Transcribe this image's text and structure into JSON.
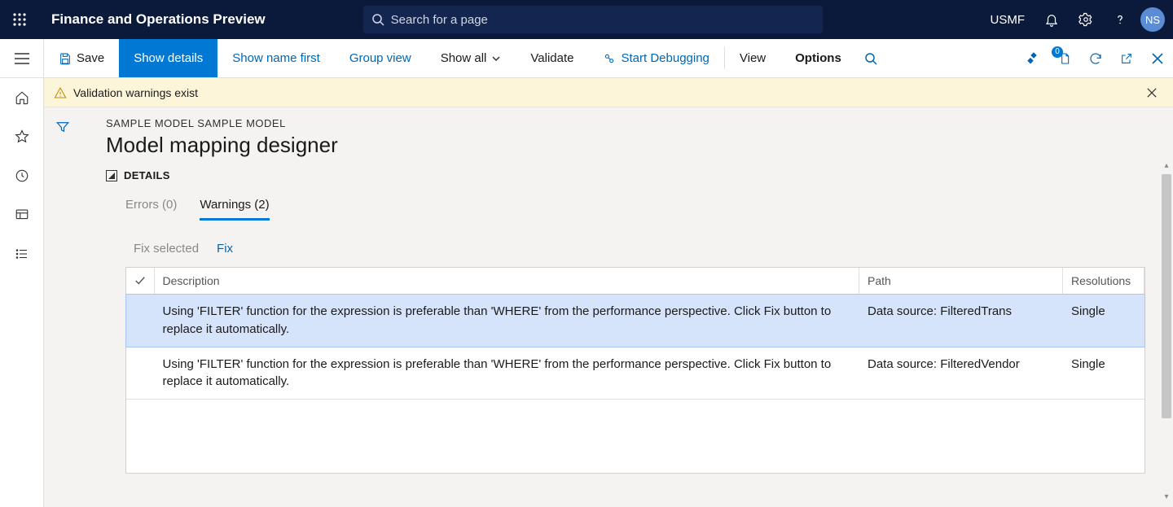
{
  "header": {
    "app_title": "Finance and Operations Preview",
    "search_placeholder": "Search for a page",
    "entity": "USMF",
    "avatar_initials": "NS"
  },
  "actionbar": {
    "save": "Save",
    "show_details": "Show details",
    "show_name_first": "Show name first",
    "group_view": "Group view",
    "show_all": "Show all",
    "validate": "Validate",
    "start_debugging": "Start Debugging",
    "view": "View",
    "options": "Options",
    "badge_count": "0"
  },
  "banner": {
    "text": "Validation warnings exist"
  },
  "page": {
    "breadcrumb": "SAMPLE MODEL SAMPLE MODEL",
    "title": "Model mapping designer",
    "section": "DETAILS"
  },
  "tabs": {
    "errors_label": "Errors (0)",
    "warnings_label": "Warnings (2)"
  },
  "toolbar2": {
    "fix_selected": "Fix selected",
    "fix": "Fix"
  },
  "grid": {
    "columns": {
      "description": "Description",
      "path": "Path",
      "resolutions": "Resolutions"
    },
    "rows": [
      {
        "description": "Using 'FILTER' function for the expression is preferable than 'WHERE' from the performance perspective. Click Fix button to replace it automatically.",
        "path": "Data source: FilteredTrans",
        "resolutions": "Single",
        "selected": true
      },
      {
        "description": "Using 'FILTER' function for the expression is preferable than 'WHERE' from the performance perspective. Click Fix button to replace it automatically.",
        "path": "Data source: FilteredVendor",
        "resolutions": "Single",
        "selected": false
      }
    ]
  }
}
